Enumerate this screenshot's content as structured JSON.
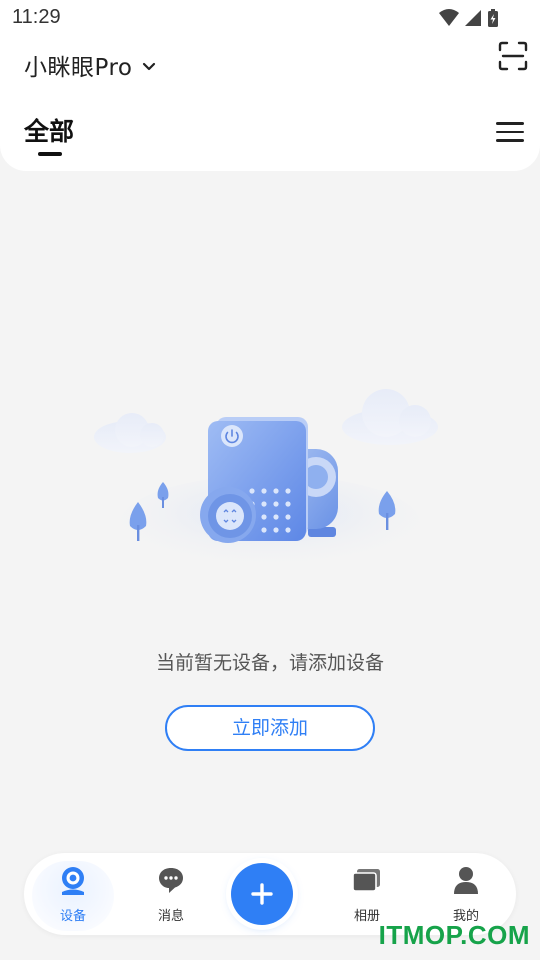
{
  "status_bar": {
    "time": "11:29",
    "icons": [
      "wifi-icon",
      "cellular-signal-icon",
      "battery-charging-icon"
    ]
  },
  "header": {
    "app_title": "小眯眼Pro",
    "app_title_icon": "chevron-down-icon",
    "scan_icon": "scan-icon",
    "tab_label": "全部",
    "menu_icon": "menu-icon"
  },
  "empty_state": {
    "message": "当前暂无设备，请添加设备",
    "add_button_label": "立即添加",
    "illustration": "device-empty-illustration"
  },
  "bottom_nav": {
    "items": [
      {
        "label": "设备",
        "icon": "camera-icon",
        "active": true
      },
      {
        "label": "消息",
        "icon": "message-icon",
        "active": false
      },
      {
        "label": "",
        "icon": "plus-icon",
        "active": false
      },
      {
        "label": "相册",
        "icon": "album-icon",
        "active": false
      },
      {
        "label": "我的",
        "icon": "user-icon",
        "active": false
      }
    ]
  },
  "watermark": "ITMOP.COM",
  "colors": {
    "accent": "#2f7ff5",
    "background": "#f4f4f4",
    "watermark": "#16a34a"
  }
}
